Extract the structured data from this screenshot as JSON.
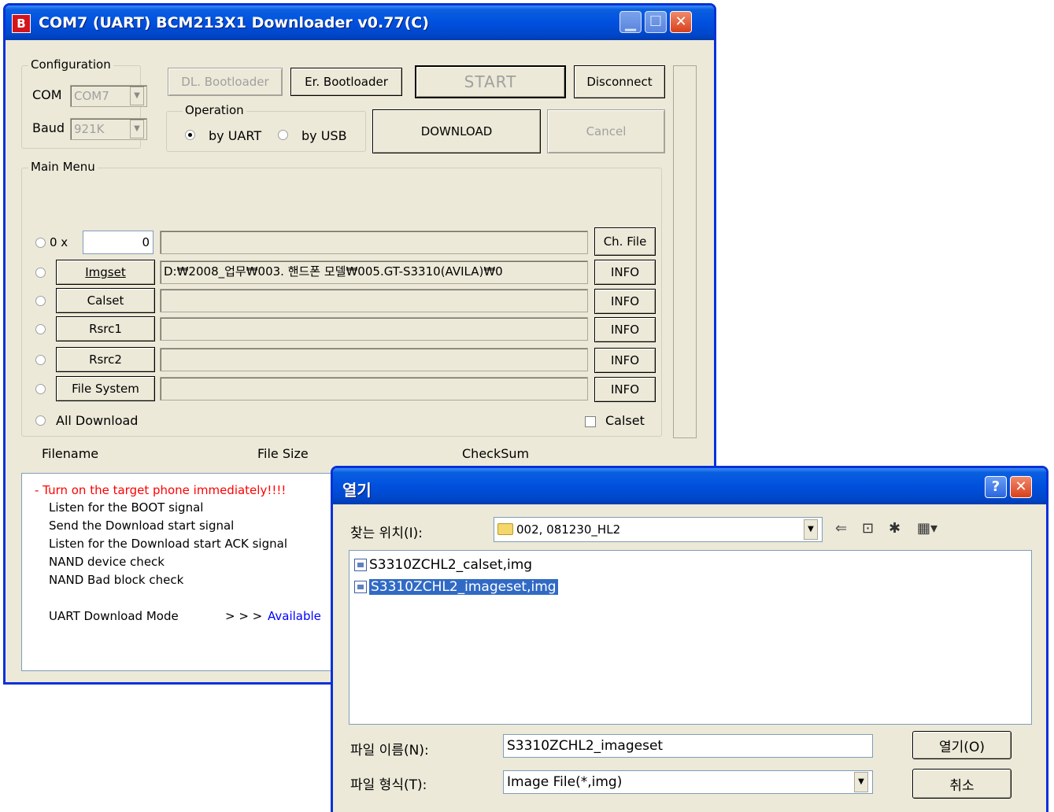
{
  "main_window": {
    "title": "COM7 (UART)   BCM213X1 Downloader v0.77(C)",
    "app_icon_letter": "B",
    "configuration": {
      "legend": "Configuration",
      "com_label": "COM",
      "com_value": "COM7",
      "baud_label": "Baud",
      "baud_value": "921K"
    },
    "buttons": {
      "dl_bootloader": "DL. Bootloader",
      "er_bootloader": "Er. Bootloader",
      "start": "START",
      "disconnect": "Disconnect",
      "download": "DOWNLOAD",
      "cancel": "Cancel"
    },
    "operation": {
      "legend": "Operation",
      "by_uart": "by UART",
      "by_usb": "by USB",
      "selected": "by UART"
    },
    "main_menu": {
      "legend": "Main Menu",
      "addr_prefix": "0 x",
      "addr_value": "0",
      "ch_file": "Ch. File",
      "rows": [
        {
          "label": "Imgset",
          "path": "D:₩2008_업무₩003. 핸드폰 모델₩005.GT-S3310(AVILA)₩0",
          "info": "INFO"
        },
        {
          "label": "Calset",
          "path": "",
          "info": "INFO"
        },
        {
          "label": "Rsrc1",
          "path": "",
          "info": "INFO"
        },
        {
          "label": "Rsrc2",
          "path": "",
          "info": "INFO"
        },
        {
          "label": "File System",
          "path": "",
          "info": "INFO"
        }
      ],
      "all_download": "All Download",
      "calset_check": "Calset"
    },
    "columns": {
      "filename": "Filename",
      "file_size": "File Size",
      "checksum": "CheckSum"
    },
    "log": {
      "warning": "- Turn on the target phone immediately!!!!",
      "lines": [
        "Listen for the BOOT signal",
        "Send the Download start signal",
        "Listen for the Download start ACK signal",
        "NAND device check",
        "NAND Bad block check"
      ],
      "mode_label": "UART Download Mode",
      "mode_arrows": "> > >",
      "mode_status": "Available"
    },
    "colors": {
      "warning": "#ff0000",
      "status": "#0000ff",
      "titlebar": "#0050de"
    }
  },
  "open_dialog": {
    "title": "열기",
    "lookin_label": "찾는 위치(I):",
    "lookin_value": "002, 081230_HL2",
    "files": [
      {
        "name": "S3310ZCHL2_calset,img",
        "selected": false
      },
      {
        "name": "S3310ZCHL2_imageset,img",
        "selected": true
      }
    ],
    "filename_label": "파일 이름(N):",
    "filename_value": "S3310ZCHL2_imageset",
    "filetype_label": "파일 형식(T):",
    "filetype_value": "Image File(*,img)",
    "open_button": "열기(O)",
    "cancel_button": "취소",
    "icons": [
      "back-arrow-icon",
      "up-folder-icon",
      "new-folder-icon",
      "view-menu-icon"
    ]
  }
}
